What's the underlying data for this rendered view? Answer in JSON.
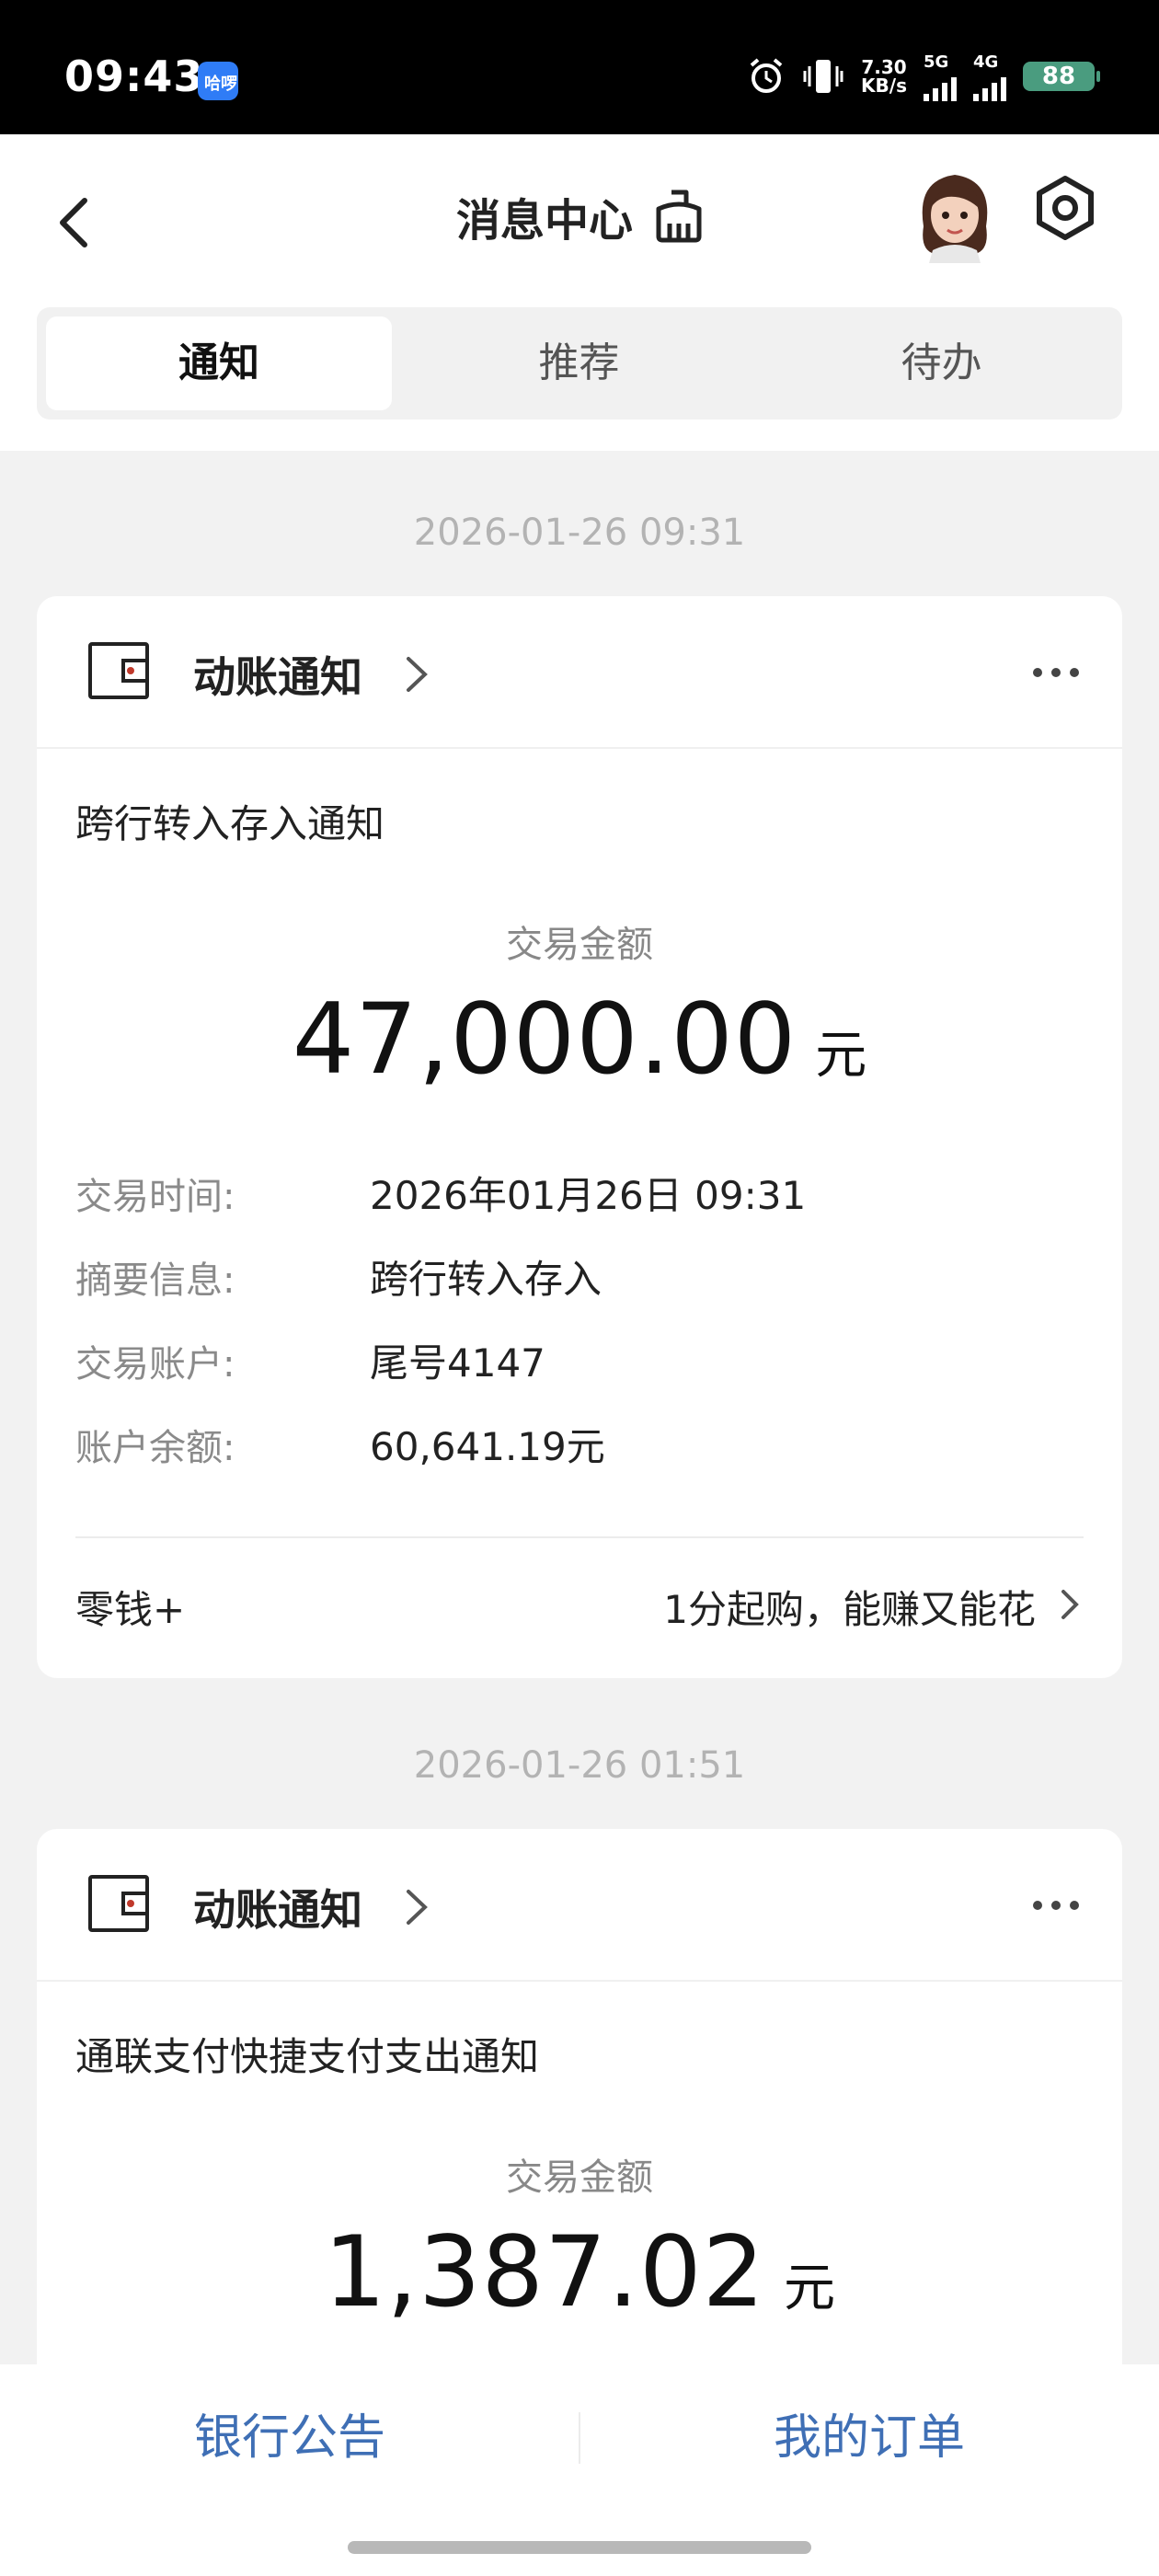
{
  "status_bar": {
    "time": "09:43",
    "app_badge": "哈啰",
    "speed_value": "7.30",
    "speed_unit": "KB/s",
    "net1": "5G",
    "net2": "4G",
    "battery": "88"
  },
  "header": {
    "title": "消息中心",
    "icons": [
      "back-chevron-icon",
      "broom-clean-icon",
      "avatar",
      "settings-hexagon-icon"
    ]
  },
  "tabs": [
    {
      "label": "通知",
      "active": true
    },
    {
      "label": "推荐",
      "active": false
    },
    {
      "label": "待办",
      "active": false
    }
  ],
  "messages": [
    {
      "timestamp": "2026-01-26 09:31",
      "category": "动账通知",
      "subject": "跨行转入存入通知",
      "amount_label": "交易金额",
      "amount": "47,000.00",
      "unit": "元",
      "details": [
        {
          "label": "交易时间:",
          "value": "2026年01月26日 09:31"
        },
        {
          "label": "摘要信息:",
          "value": "跨行转入存入"
        },
        {
          "label": "交易账户:",
          "value": "尾号4147"
        },
        {
          "label": "账户余额:",
          "value": "60,641.19元"
        }
      ],
      "promo_left": "零钱+",
      "promo_right": "1分起购，能赚又能花"
    },
    {
      "timestamp": "2026-01-26 01:51",
      "category": "动账通知",
      "subject": "通联支付快捷支付支出通知",
      "amount_label": "交易金额",
      "amount": "1,387.02",
      "unit": "元"
    }
  ],
  "bottom_bar": {
    "left_label": "银行公告",
    "right_label": "我的订单"
  },
  "colors": {
    "accent": "#3f6fb5",
    "background": "#f2f2f2",
    "wallet_red": "#c0392b"
  }
}
